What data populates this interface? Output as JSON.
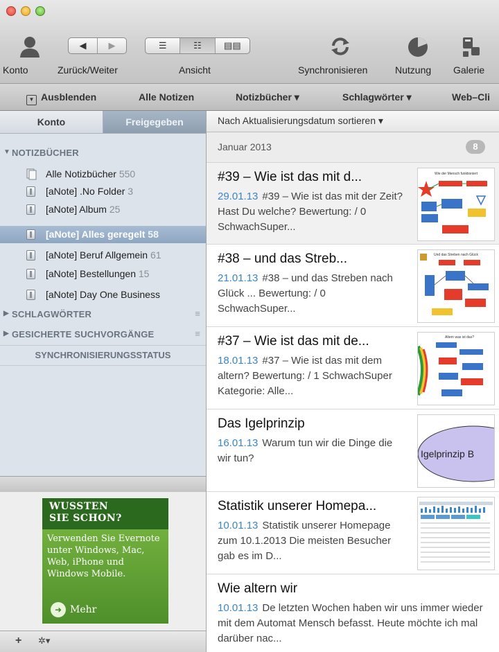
{
  "toolbar": {
    "konto_label": "Konto",
    "nav_label": "Zurück/Weiter",
    "view_label": "Ansicht",
    "sync_label": "Synchronisieren",
    "usage_label": "Nutzung",
    "gallery_label": "Galerie"
  },
  "navbar": {
    "hide": "Ausblenden",
    "all_notes": "Alle Notizen",
    "notebooks": "Notizbücher ▾",
    "tags": "Schlagwörter ▾",
    "webclip": "Web–Cli"
  },
  "sidebar": {
    "tab_account": "Konto",
    "tab_shared": "Freigegeben",
    "section_notebooks": "NOTIZBÜCHER",
    "notebooks": [
      {
        "name": "Alle Notizbücher",
        "count": "550"
      },
      {
        "name": "[aNote] .No Folder",
        "count": "3"
      },
      {
        "name": "[aNote] Album",
        "count": "25"
      },
      {
        "name": "[aNote] Alles geregelt",
        "count": "58"
      },
      {
        "name": "[aNote] Beruf Allgemein",
        "count": "61"
      },
      {
        "name": "[aNote] Bestellungen",
        "count": "15"
      },
      {
        "name": "[aNote] Day One Business",
        "count": ""
      }
    ],
    "section_tags": "SCHLAGWÖRTER",
    "section_saved": "GESICHERTE SUCHVORGÄNGE",
    "sync_status": "SYNCHRONISIERUNGSSTATUS",
    "selected_index": 3
  },
  "ad": {
    "title_line1": "WUSSTEN",
    "title_line2": "SIE SCHON?",
    "text": "Verwenden Sie Evernote unter Windows, Mac, Web, iPhone und Windows Mobile.",
    "more": "Mehr"
  },
  "bottom": {
    "add": "+",
    "gear": "✲▾"
  },
  "list": {
    "sort": "Nach Aktualisierungsdatum sortieren ▾",
    "month": "Januar 2013",
    "month_count": "8",
    "notes": [
      {
        "title": "#39 – Wie ist das mit d...",
        "date": "29.01.13",
        "snippet": "#39 – Wie ist das mit der Zeit? Hast Du welche? Bewertung: / 0 SchwachSuper...",
        "thumb_caption": "Wie der Mensch funktioniert"
      },
      {
        "title": "#38 – und das Streb...",
        "date": "21.01.13",
        "snippet": "#38 – und das Streben nach Glück ... Bewertung: / 0 SchwachSuper...",
        "thumb_caption": "Und das Streben nach Glück"
      },
      {
        "title": "#37 – Wie ist das mit de...",
        "date": "18.01.13",
        "snippet": "#37 – Wie ist das mit dem altern? Bewertung: / 1 SchwachSuper Kategorie: Alle...",
        "thumb_caption": "Altern was ist das?"
      },
      {
        "title": "Das Igelprinzip",
        "date": "16.01.13",
        "snippet": "Warum tun wir die Dinge die wir tun?",
        "thumb_caption": "Igelprinzip B"
      },
      {
        "title": "Statistik unserer Homepa...",
        "date": "10.01.13",
        "snippet": "Statistik unserer Homepage zum 10.1.2013 Die meisten Besucher gab es im D...",
        "thumb_caption": ""
      },
      {
        "title": "Wie altern wir",
        "date": "10.01.13",
        "snippet": "De letzten Wochen haben wir uns immer wieder mit dem Automat Mensch befasst. Heute möchte ich mal darüber nac..."
      }
    ]
  }
}
